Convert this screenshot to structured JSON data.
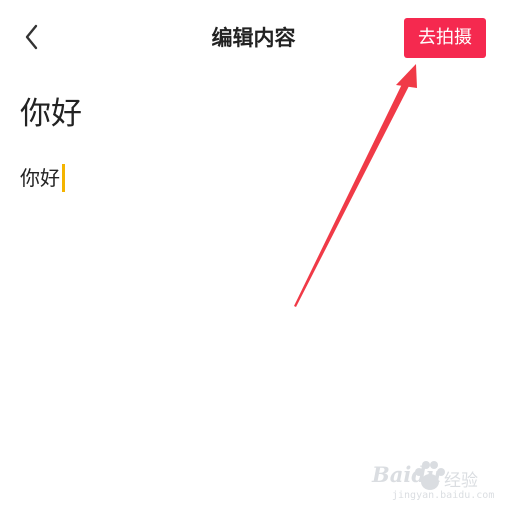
{
  "header": {
    "back_icon": "chevron-left-icon",
    "title": "编辑内容",
    "shoot_button_label": "去拍摄"
  },
  "content": {
    "title": "你好",
    "editor_text": "你好"
  },
  "watermark": {
    "brand": "Baidu",
    "suffix": "经验",
    "url": "jingyan.baidu.com"
  },
  "colors": {
    "accent": "#f5294f",
    "arrow": "#f03a47",
    "caret": "#f4b400",
    "text": "#222222"
  }
}
